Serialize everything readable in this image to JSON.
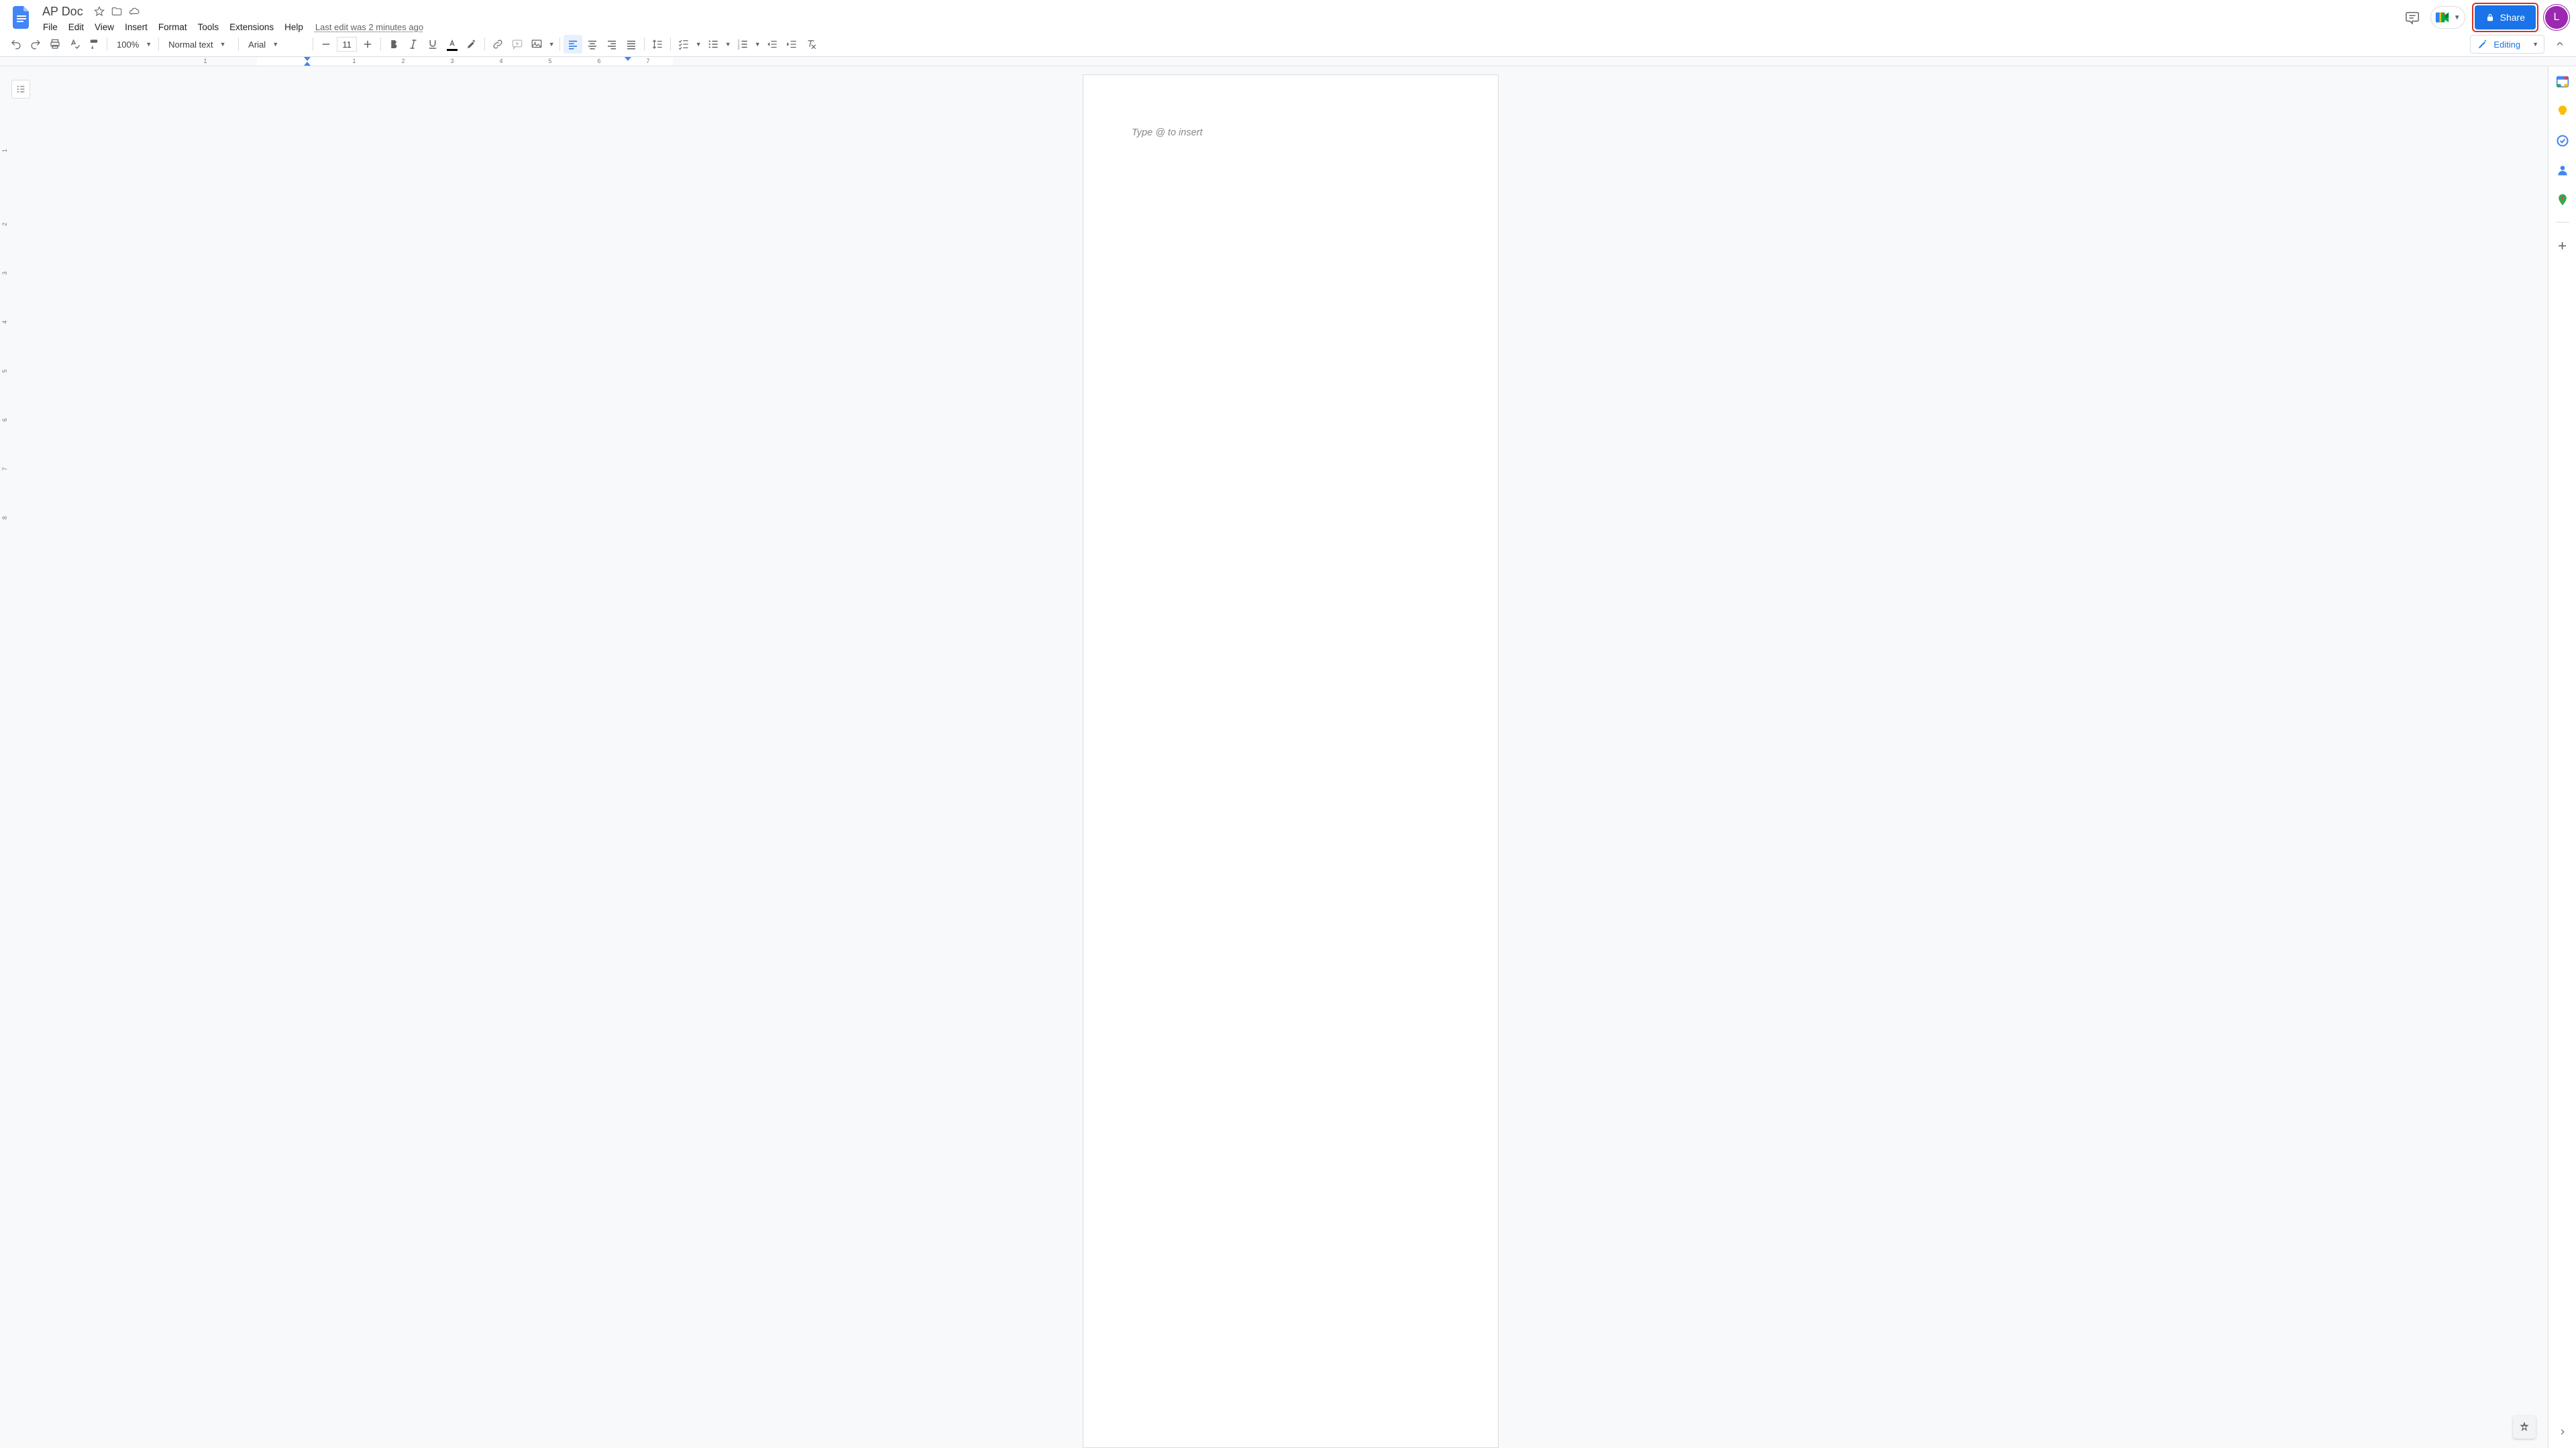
{
  "header": {
    "doc_title": "AP Doc",
    "last_edit": "Last edit was 2 minutes ago",
    "share_label": "Share",
    "avatar_initial": "L"
  },
  "menus": [
    "File",
    "Edit",
    "View",
    "Insert",
    "Format",
    "Tools",
    "Extensions",
    "Help"
  ],
  "toolbar": {
    "zoom": "100%",
    "style": "Normal text",
    "font": "Arial",
    "font_size": "11",
    "mode": "Editing"
  },
  "ruler": {
    "h_numbers": [
      "1",
      "1",
      "2",
      "3",
      "4",
      "5",
      "6",
      "7"
    ],
    "v_numbers": [
      "1",
      "2",
      "3",
      "4",
      "5",
      "6",
      "7",
      "8"
    ]
  },
  "document": {
    "placeholder": "Type @ to insert"
  },
  "sidepanel": {
    "items": [
      "calendar",
      "keep",
      "tasks",
      "contacts",
      "maps"
    ]
  }
}
